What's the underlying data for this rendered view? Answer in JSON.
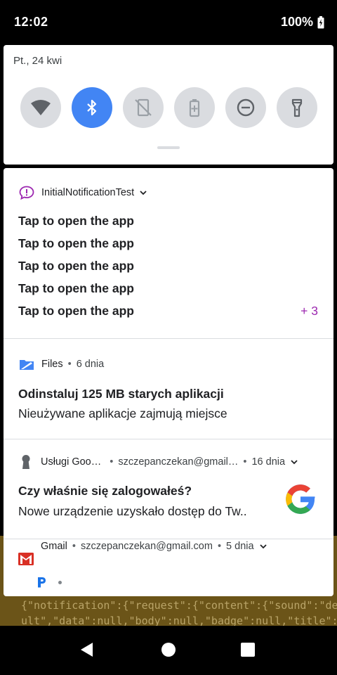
{
  "status_bar": {
    "time": "12:02",
    "battery": "100%"
  },
  "quick_settings": {
    "date": "Pt., 24 kwi",
    "tiles": [
      {
        "name": "wifi",
        "active": false
      },
      {
        "name": "bluetooth",
        "active": true
      },
      {
        "name": "auto-rotate",
        "active": false
      },
      {
        "name": "battery-saver",
        "active": false
      },
      {
        "name": "do-not-disturb",
        "active": false
      },
      {
        "name": "flashlight",
        "active": false
      }
    ]
  },
  "notifications": {
    "initial": {
      "app_name": "InitialNotificationTest",
      "messages": [
        "Tap to open the app",
        "Tap to open the app",
        "Tap to open the app",
        "Tap to open the app",
        "Tap to open the app"
      ],
      "more_count": "+ 3",
      "accent_color": "#9c27b0"
    },
    "files": {
      "app_name": "Files",
      "time": "6 dnia",
      "title": "Odinstaluj 125 MB starych aplikacji",
      "text": "Nieużywane aplikacje zajmują miejsce"
    },
    "google": {
      "app_name": "Usługi Goo…",
      "account": "szczepanczekan@gmail…",
      "time": "16 dnia",
      "title": "Czy właśnie się zalogowałeś?",
      "text": "Nowe urządzenie uzyskało dostęp do Tw.."
    },
    "gmail": {
      "app_name": "Gmail",
      "account": "szczepanczekan@gmail.com",
      "time": "5 dnia"
    }
  },
  "background_app_text": "{\"notification\":{\"request\":{\"content\":{\"sound\":\"defa\nult\",\"data\":null,\"body\":null,\"badge\":null,\"title\":\"Tap …"
}
